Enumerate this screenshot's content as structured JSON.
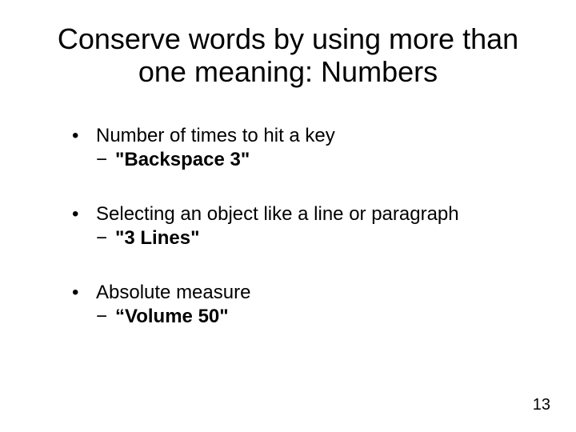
{
  "title": "Conserve words by using more than one meaning: Numbers",
  "bullets": [
    {
      "text": "Number of times to hit a key",
      "sub": "\"Backspace 3\""
    },
    {
      "text": "Selecting an object like a line or paragraph",
      "sub": "\"3 Lines\""
    },
    {
      "text": "Absolute measure",
      "sub": "“Volume 50\""
    }
  ],
  "page_number": "13",
  "marks": {
    "bullet": "•",
    "dash": "−"
  }
}
